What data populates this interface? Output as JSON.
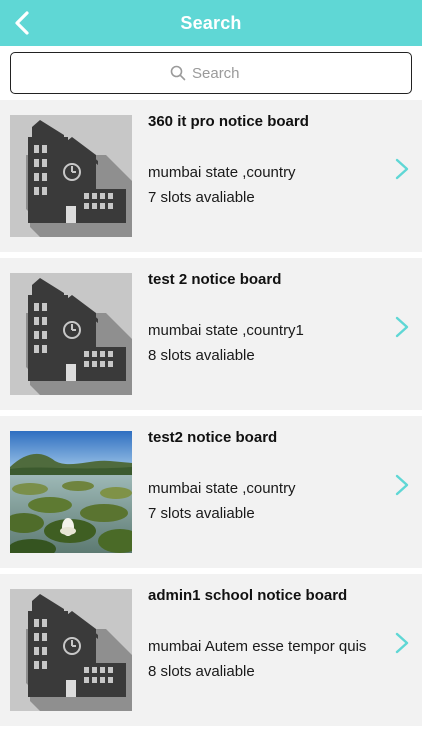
{
  "header": {
    "title": "Search",
    "back_icon": "chevron-left-icon",
    "bg_color": "#5fd7d5"
  },
  "search": {
    "placeholder": "Search",
    "value": "",
    "icon": "search-icon"
  },
  "accent_color": "#5fd7d5",
  "notice_boards": [
    {
      "title": "360 it pro notice board",
      "location": "mumbai state ,country",
      "slots": "7 slots avaliable",
      "image": "building-icon"
    },
    {
      "title": "test 2 notice board",
      "location": "mumbai state ,country1",
      "slots": "8 slots avaliable",
      "image": "building-icon"
    },
    {
      "title": "test2 notice board",
      "location": "mumbai state ,country",
      "slots": "7 slots avaliable",
      "image": "lake-photo"
    },
    {
      "title": "admin1 school notice board",
      "location": "mumbai Autem esse tempor quis",
      "slots": "8 slots avaliable",
      "image": "building-icon"
    }
  ]
}
